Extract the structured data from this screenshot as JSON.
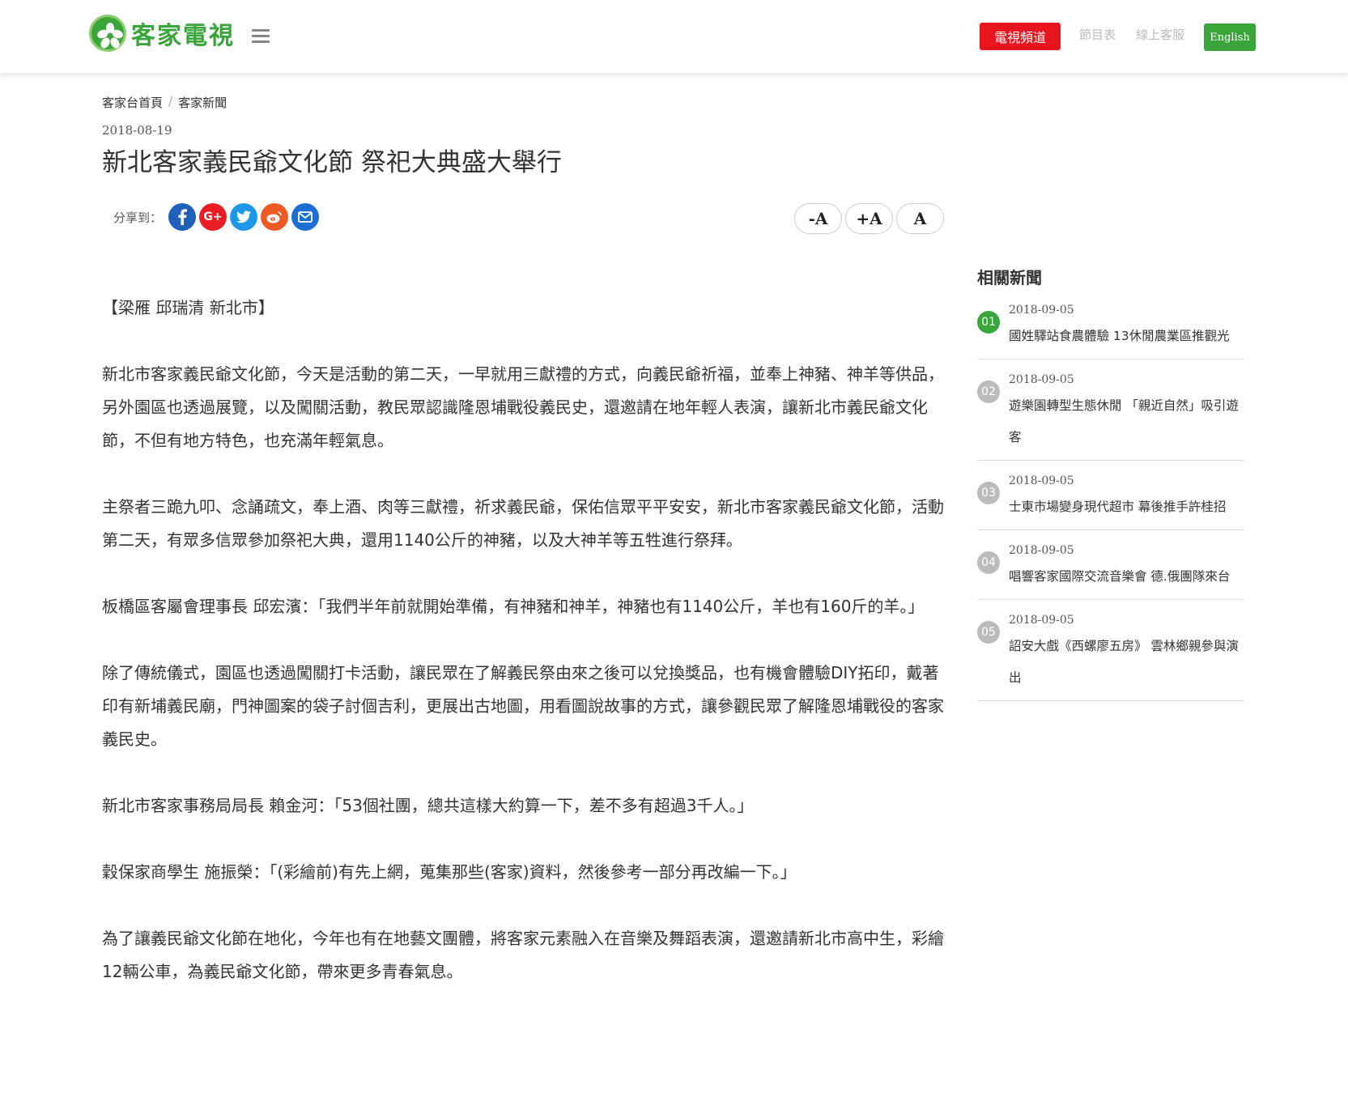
{
  "header": {
    "logo_text": "客家電視",
    "tv_button": "電視頻道",
    "schedule_link": "節目表",
    "service_link": "線上客服",
    "lang_button": "English",
    "accent_color": "#3aa53a",
    "tv_button_color": "#e8141e"
  },
  "breadcrumb": {
    "home": "客家台首頁",
    "separator": "/",
    "section": "客家新聞"
  },
  "article": {
    "date": "2018-08-19",
    "title": "新北客家義民爺文化節 祭祀大典盛大舉行",
    "share_label": "分享到：",
    "share_icons": [
      "facebook-icon",
      "google-plus-icon",
      "twitter-icon",
      "weibo-icon",
      "email-icon"
    ],
    "font_buttons": [
      "-A",
      "+A",
      "A"
    ],
    "paragraphs": [
      "【梁雁 邱瑞清 新北市】",
      "新北市客家義民爺文化節，今天是活動的第二天，一早就用三獻禮的方式，向義民爺祈福，並奉上神豬、神羊等供品，另外園區也透過展覽，以及闖關活動，教民眾認識隆恩埔戰役義民史，還邀請在地年輕人表演，讓新北市義民爺文化節，不但有地方特色，也充滿年輕氣息。",
      "主祭者三跪九叩、念誦疏文，奉上酒、肉等三獻禮，祈求義民爺，保佑信眾平平安安，新北市客家義民爺文化節，活動第二天，有眾多信眾參加祭祀大典，還用1140公斤的神豬，以及大神羊等五牲進行祭拜。",
      "板橋區客屬會理事長 邱宏濱：「我們半年前就開始準備，有神豬和神羊，神豬也有1140公斤，羊也有160斤的羊。」",
      "除了傳統儀式，園區也透過闖關打卡活動，讓民眾在了解義民祭由來之後可以兌換獎品，也有機會體驗DIY拓印，戴著印有新埔義民廟，門神圖案的袋子討個吉利，更展出古地圖，用看圖說故事的方式，讓參觀民眾了解隆恩埔戰役的客家義民史。",
      "新北市客家事務局局長 賴金河：「53個社團，總共這樣大約算一下，差不多有超過3千人。」",
      "穀保家商學生 施振榮：「(彩繪前)有先上網，蒐集那些(客家)資料，然後參考一部分再改編一下。」",
      "為了讓義民爺文化節在地化，今年也有在地藝文團體，將客家元素融入在音樂及舞蹈表演，還邀請新北市高中生，彩繪12輛公車，為義民爺文化節，帶來更多青春氣息。"
    ]
  },
  "sidebar": {
    "title": "相關新聞",
    "items": [
      {
        "num": "01",
        "date": "2018-09-05",
        "title": "國姓驛站食農體驗 13休閒農業區推觀光"
      },
      {
        "num": "02",
        "date": "2018-09-05",
        "title": "遊樂園轉型生態休閒 「親近自然」吸引遊客"
      },
      {
        "num": "03",
        "date": "2018-09-05",
        "title": "士東市場變身現代超市 幕後推手許桂招"
      },
      {
        "num": "04",
        "date": "2018-09-05",
        "title": "唱響客家國際交流音樂會 德.俄團隊來台"
      },
      {
        "num": "05",
        "date": "2018-09-05",
        "title": "詔安大戲《西螺廖五房》 雲林鄉親參與演出"
      }
    ]
  }
}
